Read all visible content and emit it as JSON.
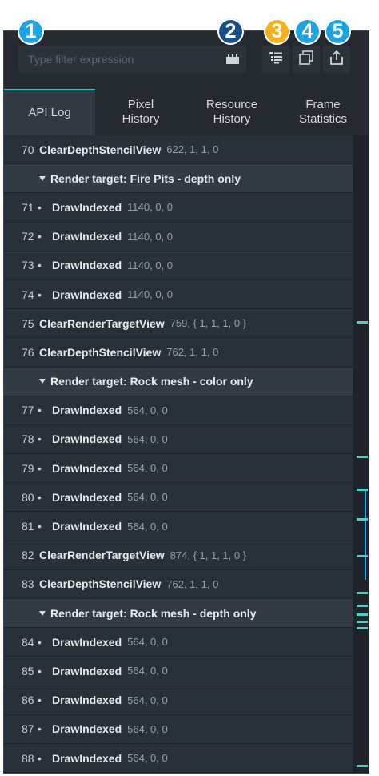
{
  "badges": [
    "1",
    "2",
    "3",
    "4",
    "5"
  ],
  "filter": {
    "placeholder": "Type filter expression",
    "value": ""
  },
  "toolbar": {
    "icons": [
      "filter-icon",
      "list-options-icon",
      "copy-icon",
      "export-icon"
    ]
  },
  "tabs": [
    {
      "label": "API Log",
      "active": true
    },
    {
      "label": "Pixel\nHistory",
      "active": false
    },
    {
      "label": "Resource\nHistory",
      "active": false
    },
    {
      "label": "Frame\nStatistics",
      "active": false
    }
  ],
  "rows": [
    {
      "type": "call",
      "num": "70",
      "name": "ClearDepthStencilView",
      "args": "622, 1, 1, 0"
    },
    {
      "type": "header",
      "label": "Render target: Fire Pits - depth only"
    },
    {
      "type": "draw",
      "num": "71",
      "name": "DrawIndexed",
      "args": "1140, 0, 0"
    },
    {
      "type": "draw",
      "num": "72",
      "name": "DrawIndexed",
      "args": "1140, 0, 0"
    },
    {
      "type": "draw",
      "num": "73",
      "name": "DrawIndexed",
      "args": "1140, 0, 0"
    },
    {
      "type": "draw",
      "num": "74",
      "name": "DrawIndexed",
      "args": "1140, 0, 0"
    },
    {
      "type": "call",
      "num": "75",
      "name": "ClearRenderTargetView",
      "args": "759, { 1, 1, 1, 0 }"
    },
    {
      "type": "call",
      "num": "76",
      "name": "ClearDepthStencilView",
      "args": "762, 1, 1, 0"
    },
    {
      "type": "header",
      "label": "Render target: Rock mesh - color only"
    },
    {
      "type": "draw",
      "num": "77",
      "name": "DrawIndexed",
      "args": "564, 0, 0"
    },
    {
      "type": "draw",
      "num": "78",
      "name": "DrawIndexed",
      "args": "564, 0, 0"
    },
    {
      "type": "draw",
      "num": "79",
      "name": "DrawIndexed",
      "args": "564, 0, 0"
    },
    {
      "type": "draw",
      "num": "80",
      "name": "DrawIndexed",
      "args": "564, 0, 0"
    },
    {
      "type": "draw",
      "num": "81",
      "name": "DrawIndexed",
      "args": "564, 0, 0"
    },
    {
      "type": "call",
      "num": "82",
      "name": "ClearRenderTargetView",
      "args": "874, { 1, 1, 1, 0 }"
    },
    {
      "type": "call",
      "num": "83",
      "name": "ClearDepthStencilView",
      "args": "762, 1, 1, 0"
    },
    {
      "type": "header",
      "label": "Render target: Rock mesh - depth only"
    },
    {
      "type": "draw",
      "num": "84",
      "name": "DrawIndexed",
      "args": "564, 0, 0"
    },
    {
      "type": "draw",
      "num": "85",
      "name": "DrawIndexed",
      "args": "564, 0, 0"
    },
    {
      "type": "draw",
      "num": "86",
      "name": "DrawIndexed",
      "args": "564, 0, 0"
    },
    {
      "type": "draw",
      "num": "87",
      "name": "DrawIndexed",
      "args": "564, 0, 0"
    },
    {
      "type": "draw",
      "num": "88",
      "name": "DrawIndexed",
      "args": "564, 0, 0"
    }
  ],
  "colors": {
    "accent": "#45d0c8",
    "selection_line": "#35a6e0",
    "panel": "#252a31",
    "row": "#283039",
    "header_row": "#323a44"
  }
}
